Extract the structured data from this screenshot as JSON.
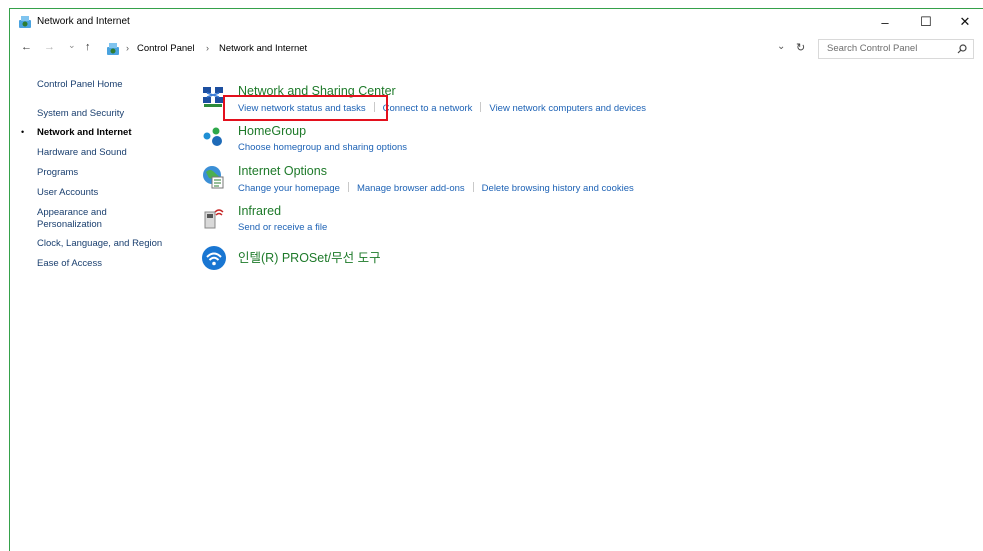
{
  "window": {
    "title": "Network and Internet",
    "minimize_glyph": "–",
    "maximize_glyph": "☐",
    "close_glyph": "✕"
  },
  "address": {
    "back_glyph": "←",
    "forward_glyph": "→",
    "recent_glyph": "⌄",
    "up_glyph": "↑",
    "crumbs": [
      "Control Panel",
      "Network and Internet"
    ],
    "crumb_separator": "›",
    "dropdown_glyph": "⌄",
    "refresh_glyph": "↻"
  },
  "search": {
    "placeholder": "Search Control Panel",
    "icon": "search-icon"
  },
  "sidebar": {
    "items": [
      {
        "label": "Control Panel Home"
      },
      {
        "label": "System and Security"
      },
      {
        "label": "Network and Internet",
        "active": true
      },
      {
        "label": "Hardware and Sound"
      },
      {
        "label": "Programs"
      },
      {
        "label": "User Accounts"
      },
      {
        "label": "Appearance and\nPersonalization"
      },
      {
        "label": "Clock, Language, and Region"
      },
      {
        "label": "Ease of Access"
      }
    ],
    "bullet": "•"
  },
  "categories": [
    {
      "title": "Network and Sharing Center",
      "icon": "network-sharing-icon",
      "links": [
        "View network status and tasks",
        "Connect to a network",
        "View network computers and devices"
      ]
    },
    {
      "title": "HomeGroup",
      "icon": "homegroup-icon",
      "links": [
        "Choose homegroup and sharing options"
      ]
    },
    {
      "title": "Internet Options",
      "icon": "internet-options-icon",
      "links": [
        "Change your homepage",
        "Manage browser add-ons",
        "Delete browsing history and cookies"
      ]
    },
    {
      "title": "Infrared",
      "icon": "infrared-icon",
      "links": [
        "Send or receive a file"
      ]
    },
    {
      "title": "인텔(R) PROSet/무선 도구",
      "icon": "intel-wireless-icon",
      "links": []
    }
  ],
  "colors": {
    "highlight": "#e3101d",
    "category_title": "#1e7a2a",
    "link": "#1d62b5"
  }
}
